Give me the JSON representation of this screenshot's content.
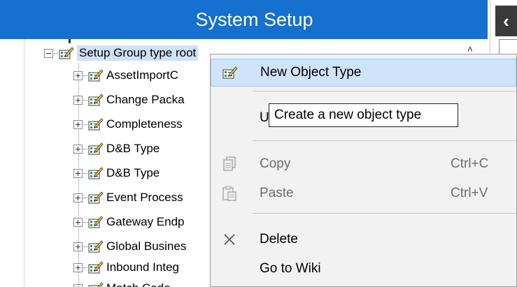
{
  "window": {
    "title": "System Setup"
  },
  "tree": {
    "root": {
      "label": "Setup Group type root"
    },
    "children": [
      {
        "label": "AssetImportC"
      },
      {
        "label": "Change Packa"
      },
      {
        "label": "Completeness"
      },
      {
        "label": "D&B  Type"
      },
      {
        "label": "D&B  Type"
      },
      {
        "label": "Event Process"
      },
      {
        "label": "Gateway Endp"
      },
      {
        "label": "Global Busines"
      },
      {
        "label": "Inbound Integ"
      },
      {
        "label": "Match Code"
      }
    ]
  },
  "context_menu": {
    "items": [
      {
        "label": "New Object Type",
        "shortcut": "",
        "icon": "object-type-icon",
        "state": "highlighted"
      },
      {
        "label": "U",
        "shortcut": "",
        "icon": "",
        "state": "normal"
      },
      {
        "label": "Copy",
        "shortcut": "Ctrl+C",
        "icon": "copy-icon",
        "state": "disabled"
      },
      {
        "label": "Paste",
        "shortcut": "Ctrl+V",
        "icon": "paste-icon",
        "state": "disabled"
      },
      {
        "label": "Delete",
        "shortcut": "",
        "icon": "delete-x-icon",
        "state": "normal"
      },
      {
        "label": "Go to Wiki",
        "shortcut": "",
        "icon": "",
        "state": "normal"
      }
    ]
  },
  "tooltip": {
    "text": "Create a new object type"
  },
  "colors": {
    "title_bar": "#1670d0",
    "selection": "#cfe0f7",
    "menu_highlight": "#cfe4fa",
    "menu_background": "#f2f2f2"
  }
}
